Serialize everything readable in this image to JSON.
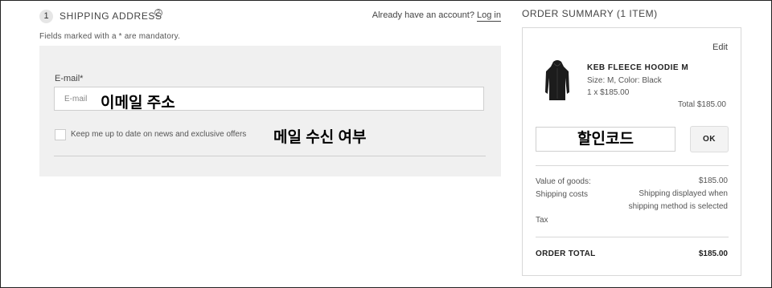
{
  "shipping": {
    "step_number": "1",
    "title": "SHIPPING ADDRESS",
    "help_glyph": "?",
    "account_prompt": "Already have an account?",
    "login_link": "Log in",
    "mandatory_note": "Fields marked with a * are mandatory.",
    "email_label": "E-mail*",
    "email_placeholder": "E-mail",
    "email_annotation": "이메일 주소",
    "newsletter_label": "Keep me up to date on news and exclusive offers",
    "newsletter_annotation": "메일 수신 여부",
    "newsletter_checked": false
  },
  "summary": {
    "title": "ORDER SUMMARY (1 ITEM)",
    "edit_label": "Edit",
    "product": {
      "name": "KEB FLEECE HOODIE M",
      "variant": "Size:  M,  Color:  Black",
      "quantity_price": "1 x $185.00",
      "total": "Total  $185.00",
      "thumbnail_icon": "hoodie-icon"
    },
    "coupon_annotation": "할인코드",
    "ok_label": "OK",
    "value_of_goods_label": "Value of goods:",
    "value_of_goods": "$185.00",
    "shipping_costs_label": "Shipping costs",
    "shipping_costs_line1": "Shipping displayed when",
    "shipping_costs_line2": "shipping method is selected",
    "tax_label": "Tax",
    "order_total_label": "ORDER TOTAL",
    "order_total": "$185.00"
  },
  "colors": {
    "panel_background": "#f0f0f0",
    "border": "#d8d8d8",
    "text": "#333333"
  }
}
